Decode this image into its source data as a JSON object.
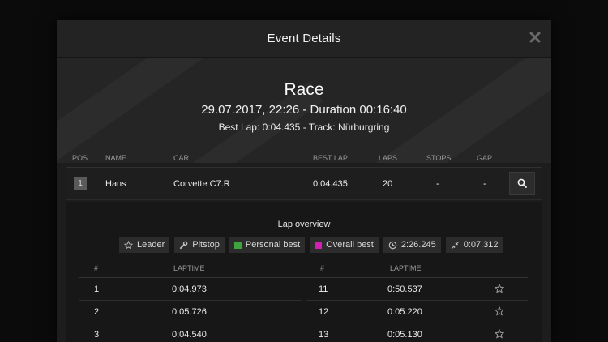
{
  "modal": {
    "title": "Event Details"
  },
  "event": {
    "title": "Race",
    "datetime": "29.07.2017, 22:26 - Duration 00:16:40",
    "best_lap_line": "Best Lap: 0:04.435 - Track: Nürburgring"
  },
  "results": {
    "columns": {
      "pos": "POS",
      "name": "NAME",
      "car": "CAR",
      "best_lap": "BEST LAP",
      "laps": "LAPS",
      "stops": "STOPS",
      "gap": "GAP"
    },
    "rows": [
      {
        "pos": "1",
        "name": "Hans",
        "car": "Corvette C7.R",
        "best_lap": "0:04.435",
        "laps": "20",
        "stops": "-",
        "gap": "-"
      }
    ]
  },
  "lap_overview": {
    "title": "Lap overview",
    "legend": {
      "leader": "Leader",
      "pitstop": "Pitstop",
      "personal_best": "Personal best",
      "overall_best": "Overall best",
      "total_time": "2:26.245",
      "time_diff": "0:07.312"
    },
    "legend_colors": {
      "personal_best": "#3ea33e",
      "overall_best": "#d21fb4"
    },
    "columns": {
      "num": "#",
      "laptime": "LAPTIME"
    },
    "left": [
      {
        "num": "1",
        "laptime": "0:04.973"
      },
      {
        "num": "2",
        "laptime": "0:05.726"
      },
      {
        "num": "3",
        "laptime": "0:04.540"
      }
    ],
    "right": [
      {
        "num": "11",
        "laptime": "0:50.537"
      },
      {
        "num": "12",
        "laptime": "0:05.220"
      },
      {
        "num": "13",
        "laptime": "0:05.130"
      }
    ]
  }
}
